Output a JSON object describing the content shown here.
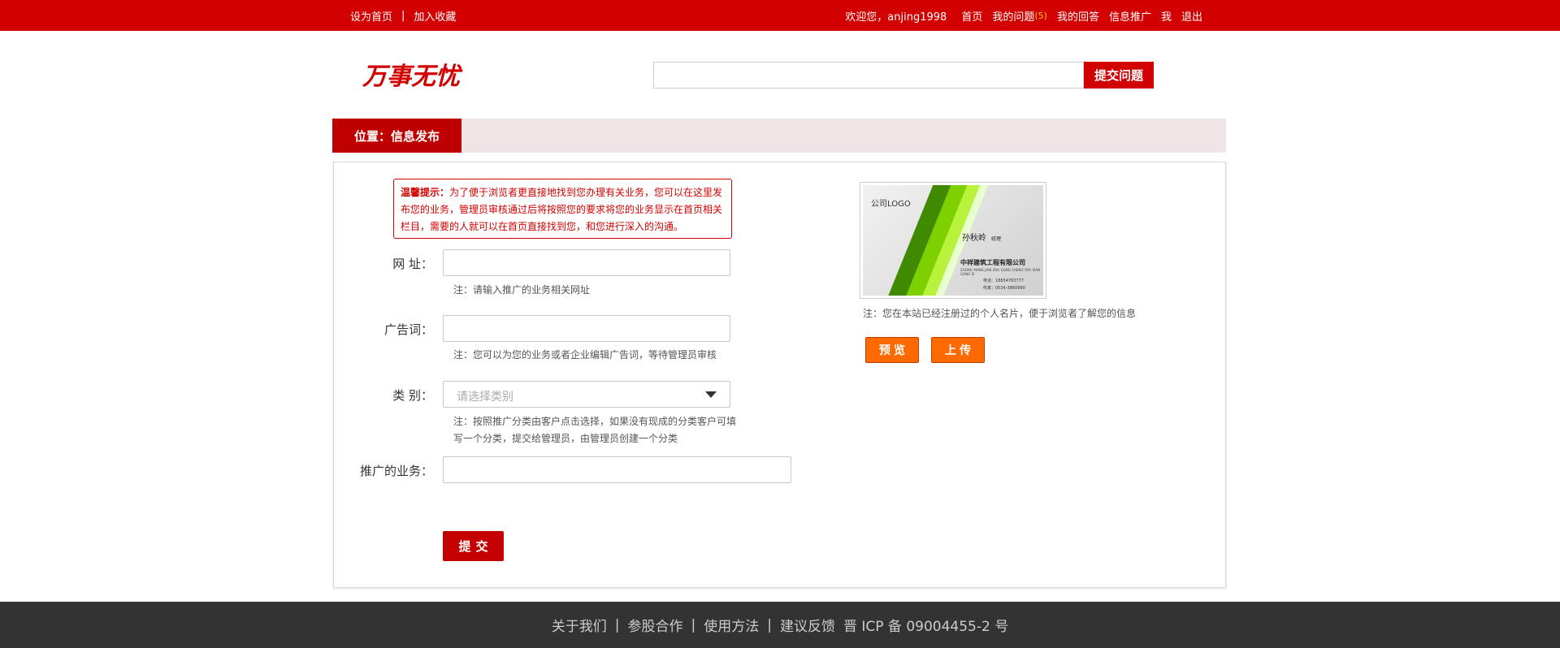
{
  "topbar": {
    "set_home": "设为首页",
    "separator": "|",
    "add_favorite": "加入收藏",
    "welcome": "欢迎您，anjing1998",
    "nav": {
      "home": "首页",
      "my_questions": "我的问题",
      "my_questions_count": "(5)",
      "my_answers": "我的回答",
      "info_promo": "信息推广",
      "me": "我",
      "logout": "退出"
    }
  },
  "header": {
    "logo_text": "万事无忧",
    "search_value": "",
    "submit_question": "提交问题"
  },
  "location": {
    "label": "位置：信息发布"
  },
  "tip": {
    "title": "温馨提示：",
    "text": "为了便于浏览者更直接地找到您办理有关业务，您可以在这里发布您的业务，管理员审核通过后将按照您的要求将您的业务显示在首页相关栏目，需要的人就可以在首页直接找到您，和您进行深入的沟通。"
  },
  "form": {
    "url_label": "网  址：",
    "url_value": "",
    "url_note": "注：请输入推广的业务相关网址",
    "ad_label": "广告词：",
    "ad_value": "",
    "ad_note": "注：您可以为您的业务或者企业编辑广告词，等待管理员审核",
    "category_label": "类  别：",
    "category_placeholder": "请选择类别",
    "category_note_1": "注：按照推广分类由客户点击选择，如果没有现成的分类客户可填",
    "category_note_2": "写一个分类，提交给管理员，由管理员创建一个分类",
    "business_label": "推广的业务：",
    "business_value": "",
    "submit": "提交"
  },
  "card": {
    "logo": "公司LOGO",
    "name": "孙秋岭",
    "title": "经理",
    "company": "中祥建筑工程有限公司",
    "pinyin": "ZHONG XIANG JIAN ZHU GONG CHENG YOU XIAN GONG SI",
    "phone": "电话：18654763777",
    "fax": "传真：0534-3860990",
    "note": "注：您在本站已经注册过的个人名片，便于浏览者了解您的信息",
    "preview_button": "预览",
    "upload_button": "上传"
  },
  "footer": {
    "about": "关于我们",
    "partner": "参股合作",
    "usage": "使用方法",
    "feedback": "建议反馈",
    "icp": "晋 ICP 备 09004455-2 号",
    "separator": "|"
  },
  "colors": {
    "brand_red": "#d20000",
    "dark_red": "#bf0000",
    "orange": "#ff6a00",
    "footer_bg": "#333333",
    "location_bg": "#efe4e6"
  }
}
